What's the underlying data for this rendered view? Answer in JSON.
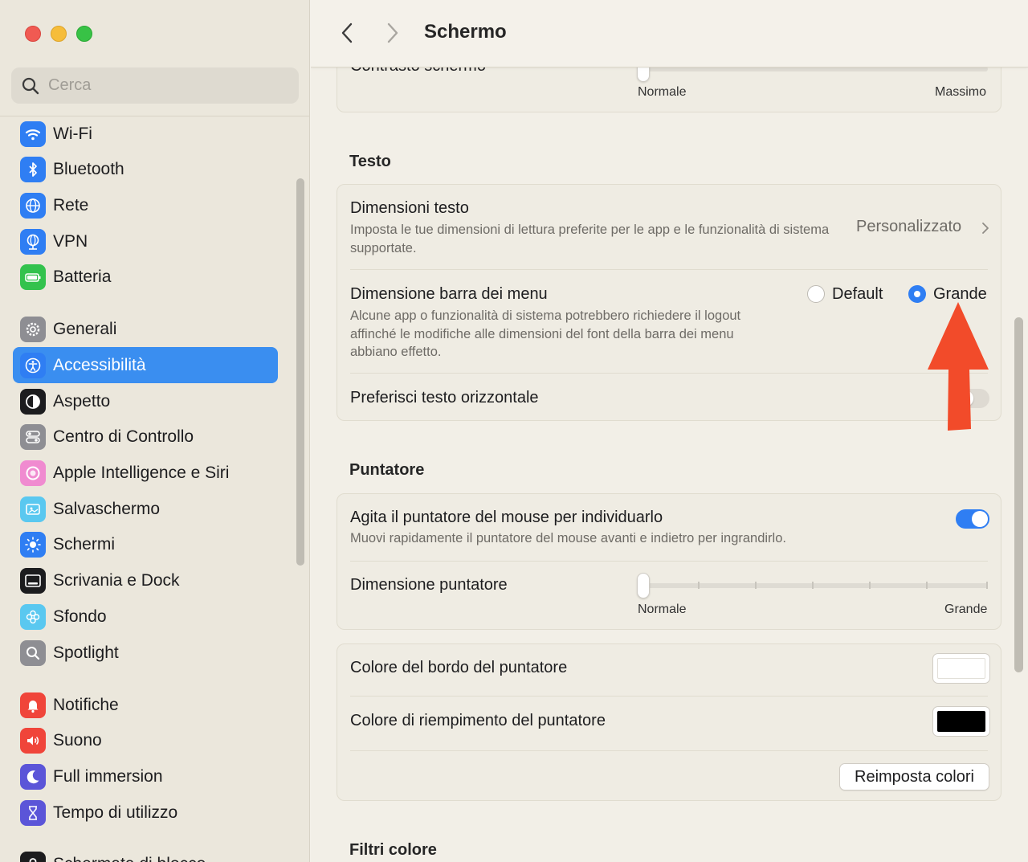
{
  "sidebar": {
    "search_placeholder": "Cerca",
    "items": [
      {
        "label": "Wi-Fi",
        "icon": "wifi-icon",
        "color": "#2f7ef3"
      },
      {
        "label": "Bluetooth",
        "icon": "bluetooth-icon",
        "color": "#2f7ef3"
      },
      {
        "label": "Rete",
        "icon": "globe-icon",
        "color": "#2f7ef3"
      },
      {
        "label": "VPN",
        "icon": "vpn-globe-icon",
        "color": "#2f7ef3"
      },
      {
        "label": "Batteria",
        "icon": "battery-icon",
        "color": "#33c24d"
      },
      {
        "label": "Generali",
        "icon": "gear-icon",
        "color": "#8e8e93"
      },
      {
        "label": "Accessibilità",
        "icon": "accessibility-icon",
        "color": "#2f7ef3",
        "active": true
      },
      {
        "label": "Aspetto",
        "icon": "appearance-icon",
        "color": "#1c1c1e"
      },
      {
        "label": "Centro di Controllo",
        "icon": "control-center-icon",
        "color": "#8e8e93"
      },
      {
        "label": "Apple Intelligence e Siri",
        "icon": "siri-icon",
        "color": "#f08bd0"
      },
      {
        "label": "Salvaschermo",
        "icon": "screensaver-icon",
        "color": "#5ac8f0"
      },
      {
        "label": "Schermi",
        "icon": "brightness-icon",
        "color": "#2f7ef3"
      },
      {
        "label": "Scrivania e Dock",
        "icon": "dock-icon",
        "color": "#1c1c1e"
      },
      {
        "label": "Sfondo",
        "icon": "wallpaper-icon",
        "color": "#5ac8f0"
      },
      {
        "label": "Spotlight",
        "icon": "spotlight-icon",
        "color": "#8e8e93"
      },
      {
        "label": "Notifiche",
        "icon": "bell-icon",
        "color": "#f0453a"
      },
      {
        "label": "Suono",
        "icon": "speaker-icon",
        "color": "#f0453a"
      },
      {
        "label": "Full immersion",
        "icon": "moon-icon",
        "color": "#5b55d8"
      },
      {
        "label": "Tempo di utilizzo",
        "icon": "hourglass-icon",
        "color": "#5b55d8"
      },
      {
        "label": "Schermata di blocco",
        "icon": "lock-icon",
        "color": "#1c1c1e"
      }
    ]
  },
  "toolbar": {
    "title": "Schermo"
  },
  "contrast": {
    "title": "Contrasto schermo",
    "min_label": "Normale",
    "max_label": "Massimo"
  },
  "text_section": {
    "heading": "Testo",
    "size_title": "Dimensioni testo",
    "size_desc": "Imposta le tue dimensioni di lettura preferite per le app e le funzionalità di sistema supportate.",
    "size_value": "Personalizzato",
    "menubar_title": "Dimensione barra dei menu",
    "menubar_desc": "Alcune app o funzionalità di sistema potrebbero richiedere il logout affinché le modifiche alle dimensioni del font della barra dei menu abbiano effetto.",
    "option_default": "Default",
    "option_large": "Grande",
    "selected": "Grande",
    "horizontal_title": "Preferisci testo orizzontale"
  },
  "pointer_section": {
    "heading": "Puntatore",
    "shake_title": "Agita il puntatore del mouse per individuarlo",
    "shake_desc": "Muovi rapidamente il puntatore del mouse avanti e indietro per ingrandirlo.",
    "shake_on": true,
    "size_title": "Dimensione puntatore",
    "size_min": "Normale",
    "size_max": "Grande",
    "border_title": "Colore del bordo del puntatore",
    "border_color": "#ffffff",
    "fill_title": "Colore di riempimento del puntatore",
    "fill_color": "#000000",
    "reset_label": "Reimposta colori"
  },
  "color_filters": {
    "heading": "Filtri colore"
  },
  "annotation": {
    "arrow_color": "#f24b2a"
  }
}
